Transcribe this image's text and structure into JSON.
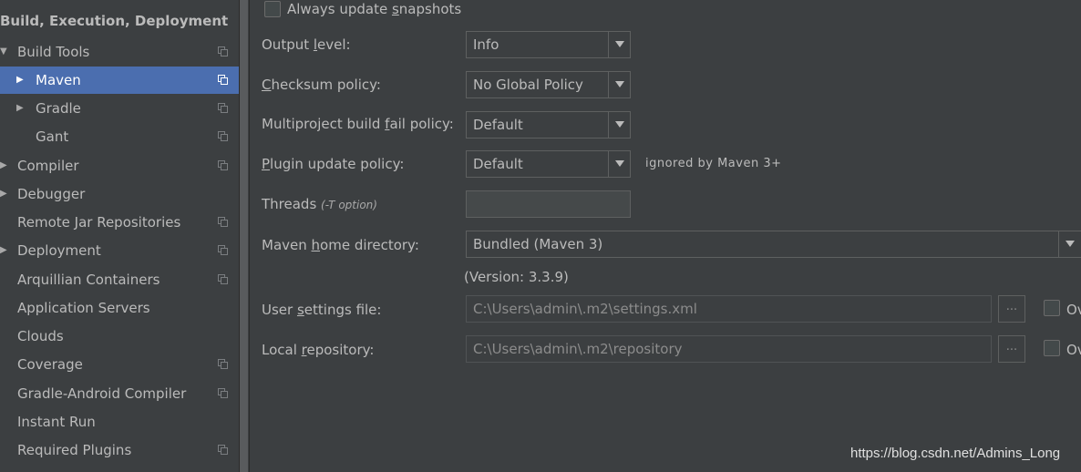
{
  "sidebar": {
    "section_title": "Build, Execution, Deployment",
    "items": [
      {
        "label": "Build Tools",
        "arrow": "▼"
      },
      {
        "label": "Maven",
        "arrow": "▶"
      },
      {
        "label": "Gradle",
        "arrow": "▶"
      },
      {
        "label": "Gant",
        "arrow": ""
      },
      {
        "label": "Compiler",
        "arrow": "▶"
      },
      {
        "label": "Debugger",
        "arrow": "▶"
      },
      {
        "label": "Remote Jar Repositories",
        "arrow": ""
      },
      {
        "label": "Deployment",
        "arrow": "▶"
      },
      {
        "label": "Arquillian Containers",
        "arrow": ""
      },
      {
        "label": "Application Servers",
        "arrow": ""
      },
      {
        "label": "Clouds",
        "arrow": ""
      },
      {
        "label": "Coverage",
        "arrow": ""
      },
      {
        "label": "Gradle-Android Compiler",
        "arrow": ""
      },
      {
        "label": "Instant Run",
        "arrow": ""
      },
      {
        "label": "Required Plugins",
        "arrow": ""
      }
    ],
    "selected_item": "Maven"
  },
  "settings": {
    "always_update_snapshots": {
      "label_pre": "Always update ",
      "label_mnemonic": "s",
      "label_post": "napshots",
      "checked": false
    },
    "output_level": {
      "label_pre": "Output ",
      "label_mnemonic": "l",
      "label_post": "evel:",
      "value": "Info"
    },
    "checksum_policy": {
      "label_pre": "",
      "label_mnemonic": "C",
      "label_post": "hecksum policy:",
      "value": "No Global Policy"
    },
    "fail_policy": {
      "label_pre": "Multiproject build ",
      "label_mnemonic": "f",
      "label_post": "ail policy:",
      "value": "Default"
    },
    "plugin_update_policy": {
      "label_pre": "",
      "label_mnemonic": "P",
      "label_post": "lugin update policy:",
      "value": "Default",
      "hint": "ignored by Maven 3+"
    },
    "threads": {
      "label": "Threads",
      "option_hint": "(-T option)",
      "value": ""
    },
    "maven_home": {
      "label_pre": "Maven ",
      "label_mnemonic": "h",
      "label_post": "ome directory:",
      "value": "Bundled (Maven 3)",
      "version": "(Version: 3.3.9)"
    },
    "user_settings": {
      "label_pre": "User ",
      "label_mnemonic": "s",
      "label_post": "ettings file:",
      "value": "C:\\Users\\admin\\.m2\\settings.xml",
      "browse": "...",
      "override_label": "Ov",
      "override_checked": false
    },
    "local_repository": {
      "label_pre": "Local ",
      "label_mnemonic": "r",
      "label_post": "epository:",
      "value": "C:\\Users\\admin\\.m2\\repository",
      "browse": "...",
      "override_label": "Ov",
      "override_checked": false
    }
  },
  "watermark": "https://blog.csdn.net/Admins_Long",
  "colors": {
    "background": "#3c3f41",
    "selection": "#4b6eaf",
    "text": "#bbbbbb"
  }
}
